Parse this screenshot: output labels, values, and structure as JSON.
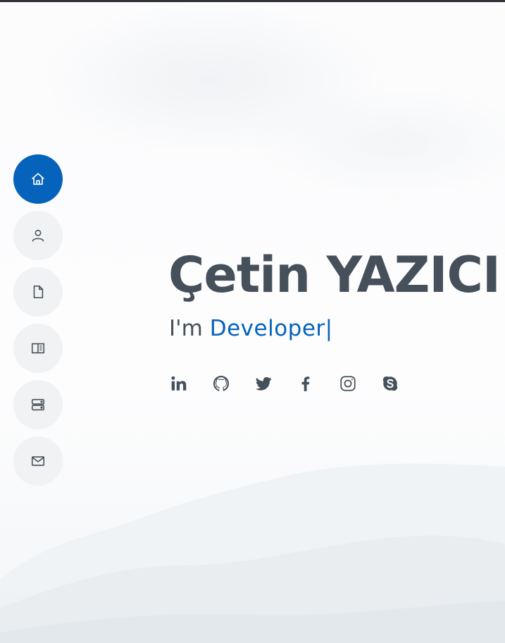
{
  "hero": {
    "name": "Çetin YAZICI",
    "intro": "I'm ",
    "typed_role": "Developer",
    "cursor": "|"
  },
  "side_nav": {
    "items": [
      {
        "icon": "house-icon",
        "active": true
      },
      {
        "icon": "person-icon",
        "active": false
      },
      {
        "icon": "file-icon",
        "active": false
      },
      {
        "icon": "book-half-icon",
        "active": false
      },
      {
        "icon": "server-icon",
        "active": false
      },
      {
        "icon": "envelope-icon",
        "active": false
      }
    ]
  },
  "social_links": [
    {
      "icon": "linkedin-icon"
    },
    {
      "icon": "github-icon"
    },
    {
      "icon": "twitter-icon"
    },
    {
      "icon": "facebook-icon"
    },
    {
      "icon": "instagram-icon"
    },
    {
      "icon": "skype-icon"
    }
  ],
  "colors": {
    "accent": "#0563bb",
    "text": "#45505b",
    "nav_bg": "#f1f2f4",
    "top_bar": "#2f3236"
  }
}
